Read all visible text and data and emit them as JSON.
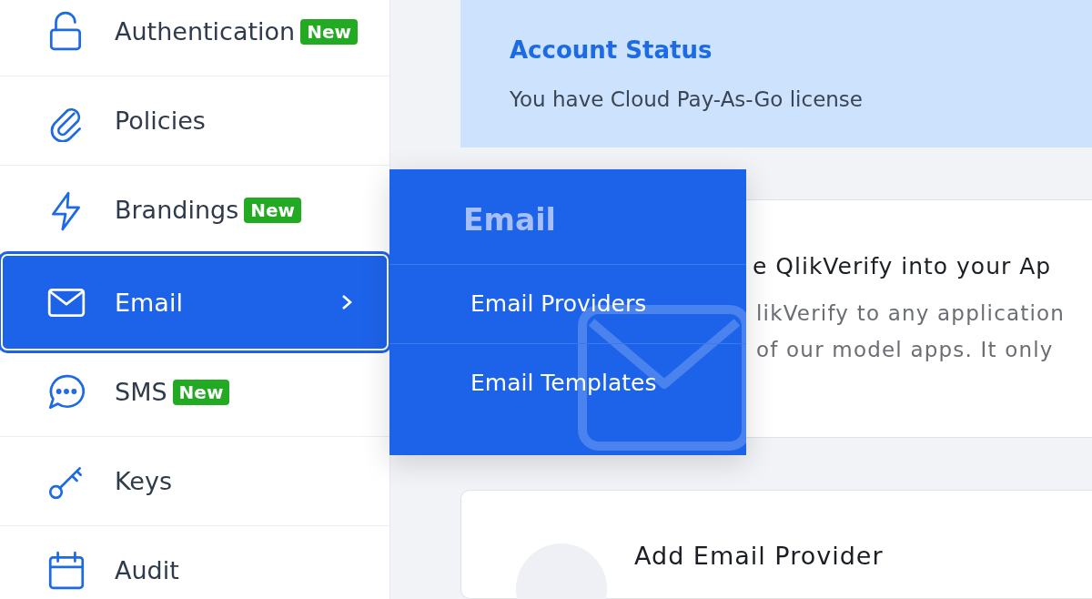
{
  "sidebar": {
    "items": [
      {
        "label": "Authentication",
        "badge": "New",
        "selected": false
      },
      {
        "label": "Policies",
        "selected": false
      },
      {
        "label": "Brandings",
        "badge": "New",
        "selected": false
      },
      {
        "label": "Email",
        "selected": true
      },
      {
        "label": "SMS",
        "badge": "New",
        "selected": false
      },
      {
        "label": "Keys",
        "selected": false
      },
      {
        "label": "Audit",
        "selected": false
      }
    ]
  },
  "banner": {
    "title": "Account Status",
    "text": "You have Cloud Pay-As-Go license"
  },
  "integration_card": {
    "title": "e QlikVerify into your Ap",
    "lines": [
      "likVerify to any application",
      "of our model apps. It only"
    ]
  },
  "provider_card": {
    "title": "Add Email Provider"
  },
  "flyout": {
    "title": "Email",
    "items": [
      "Email Providers",
      "Email Templates"
    ]
  }
}
